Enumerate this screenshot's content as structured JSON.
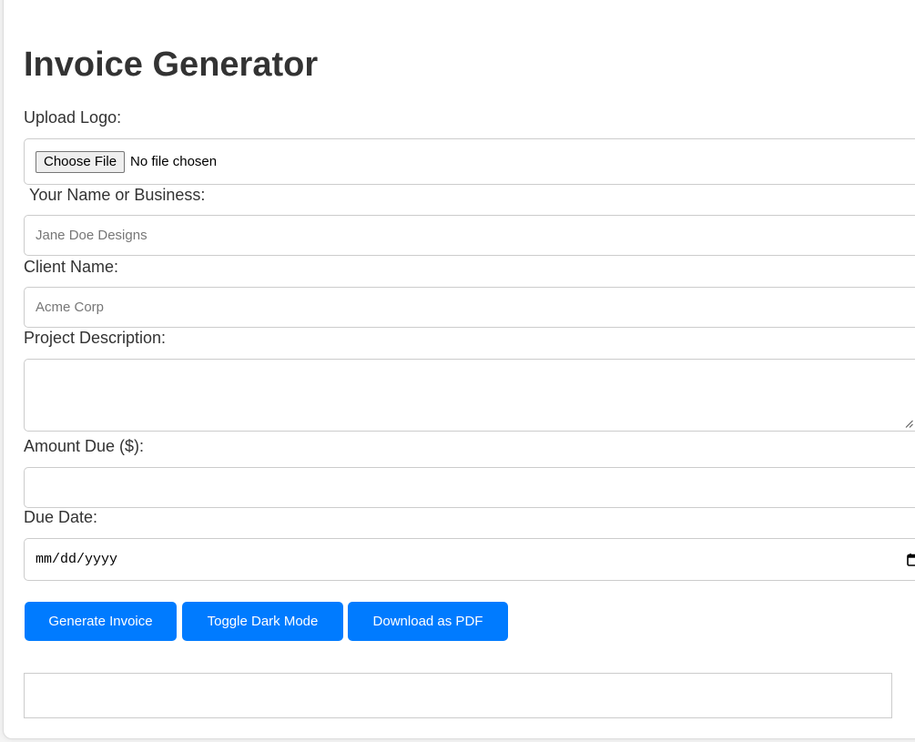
{
  "page": {
    "title": "Invoice Generator"
  },
  "form": {
    "logo": {
      "label": "Upload Logo:",
      "button_label": "Choose File",
      "status": "No file chosen"
    },
    "business_name": {
      "label": "Your Name or Business:",
      "value": "",
      "placeholder": "Jane Doe Designs"
    },
    "client_name": {
      "label": "Client Name:",
      "value": "",
      "placeholder": "Acme Corp"
    },
    "project_description": {
      "label": "Project Description:",
      "value": ""
    },
    "amount_due": {
      "label": "Amount Due ($):",
      "value": ""
    },
    "due_date": {
      "label": "Due Date:",
      "value": "mm/dd/yyyy"
    }
  },
  "actions": {
    "generate_label": "Generate Invoice",
    "toggle_dark_label": "Toggle Dark Mode",
    "download_pdf_label": "Download as PDF"
  },
  "icons": {
    "date_picker": "calendar-icon",
    "textarea_resize": "resize-grip-icon"
  },
  "colors": {
    "accent": "#007bff",
    "text": "#333333",
    "border": "#cccccc",
    "background": "#f4f4f4",
    "card": "#ffffff"
  }
}
